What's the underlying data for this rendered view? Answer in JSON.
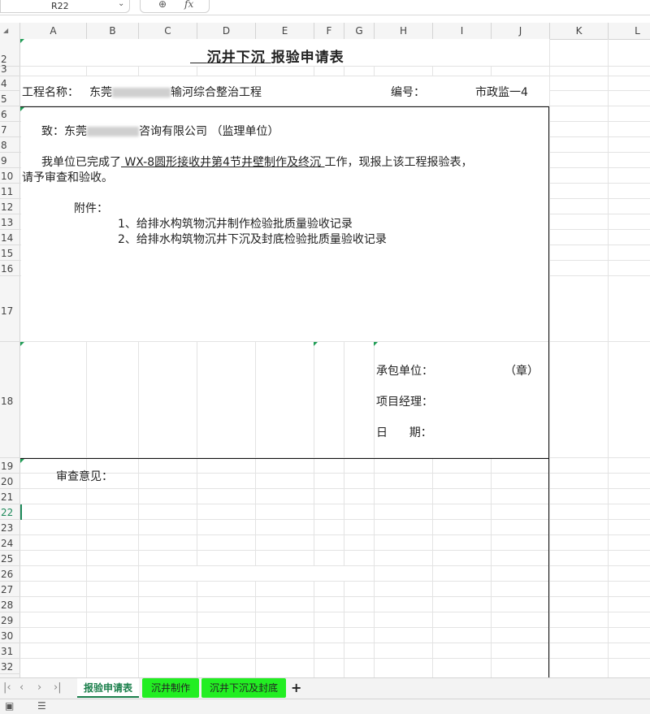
{
  "formula_bar": {
    "name_box": "R22"
  },
  "columns": [
    "A",
    "B",
    "C",
    "D",
    "E",
    "F",
    "G",
    "H",
    "I",
    "J",
    "K",
    "L"
  ],
  "rows": [
    "2",
    "3",
    "4",
    "5",
    "6",
    "7",
    "8",
    "9",
    "10",
    "11",
    "12",
    "13",
    "14",
    "15",
    "16",
    "17",
    "18",
    "19",
    "20",
    "21",
    "22",
    "23",
    "24",
    "25",
    "26",
    "27",
    "28",
    "29",
    "30",
    "31",
    "32"
  ],
  "active_row": "22",
  "form": {
    "title_part1": "沉井下沉",
    "title_part2": "报验申请表",
    "project_label": "工程名称：",
    "project_prefix": "东莞",
    "project_suffix": "输河综合整治工程",
    "number_label": "编号：",
    "number_value": "市政监一4",
    "to_prefix": "致：东莞",
    "to_mid": "咨询有限公司",
    "to_unit": "（监理单位）",
    "body_prefix": "我单位已完成了",
    "body_work": " WX-8圆形接收井第4节井壁制作及终沉  ",
    "body_suffix": "工作，现报上该工程报验表，",
    "body_line2": "请予审查和验收。",
    "attachment_label": "附件：",
    "attachment_1": "1、给排水构筑物沉井制作检验批质量验收记录",
    "attachment_2": "2、给排水构筑物沉井下沉及封底检验批质量验收记录",
    "contractor_label": "承包单位：",
    "seal_label": "（章）",
    "manager_label": "项目经理：",
    "date_label": "日      期：",
    "review_label": "审查意见："
  },
  "sheet_tabs": [
    "报验申请表",
    "沉井制作",
    "沉井下沉及封底"
  ],
  "add_sheet_label": "+",
  "colors": {
    "active_tab": "#1a7f4b",
    "green_tab": "#22ee22",
    "cell_marker": "#1f9d55"
  }
}
